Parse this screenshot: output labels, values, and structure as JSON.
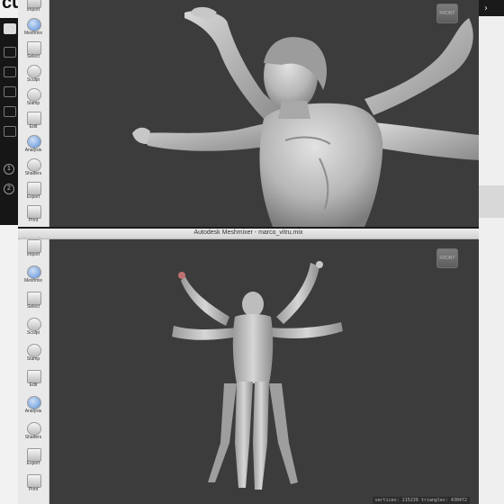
{
  "outer_app": {
    "logo_text": "cu",
    "icons": [
      "folder-icon",
      "layers-icon",
      "cube-icon",
      "cylinder-icon",
      "brush-icon",
      "sphere-icon"
    ],
    "steps": [
      "1",
      "2"
    ]
  },
  "top_window": {
    "tools": [
      {
        "label": "Import",
        "icon": "plus-icon"
      },
      {
        "label": "Meshmix",
        "icon": "meshmix-icon"
      },
      {
        "label": "Select",
        "icon": "select-icon"
      },
      {
        "label": "Sculpt",
        "icon": "brush-icon"
      },
      {
        "label": "Stamp",
        "icon": "stamp-icon"
      },
      {
        "label": "Edit",
        "icon": "edit-icon"
      },
      {
        "label": "Analysis",
        "icon": "analysis-icon"
      },
      {
        "label": "Shaders",
        "icon": "shaders-icon"
      },
      {
        "label": "Export",
        "icon": "export-icon"
      },
      {
        "label": "Print",
        "icon": "print-icon"
      }
    ],
    "viewcube_label": "FRONT"
  },
  "bottom_window": {
    "title": "Autodesk Meshmixer - marco_vitru.mix",
    "tools": [
      {
        "label": "Import",
        "icon": "plus-icon"
      },
      {
        "label": "Meshmix",
        "icon": "meshmix-icon"
      },
      {
        "label": "Select",
        "icon": "select-icon"
      },
      {
        "label": "Sculpt",
        "icon": "brush-icon"
      },
      {
        "label": "Stamp",
        "icon": "stamp-icon"
      },
      {
        "label": "Edit",
        "icon": "edit-icon"
      },
      {
        "label": "Analysis",
        "icon": "analysis-icon"
      },
      {
        "label": "Shaders",
        "icon": "shaders-icon"
      },
      {
        "label": "Export",
        "icon": "export-icon"
      },
      {
        "label": "Print",
        "icon": "print-icon"
      }
    ],
    "viewcube_label": "FRONT",
    "status": "vertices: 215239  triangles: 430472"
  },
  "colors": {
    "viewport": "#3c3c3c",
    "model": "#b9b9b9",
    "toolbar": "#e9e9e9",
    "accent": "#5b8fd6"
  }
}
